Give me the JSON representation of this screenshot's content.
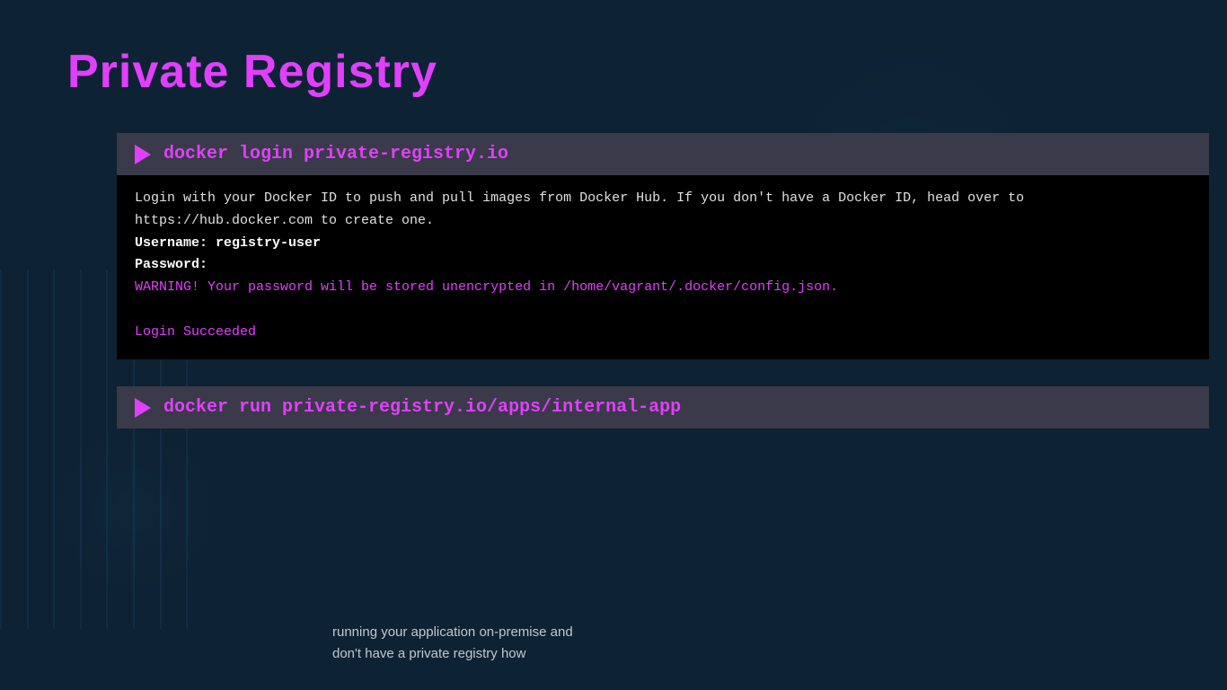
{
  "page": {
    "title": "Private Registry",
    "background_color": "#0d2233"
  },
  "terminal1": {
    "command": "docker login private-registry.io",
    "output_lines": [
      {
        "text": "Login with your Docker ID to push and pull images from Docker Hub. If you don't have a Docker ID, head over to",
        "style": "white"
      },
      {
        "text": "https://hub.docker.com to create one.",
        "style": "white"
      },
      {
        "text": "Username: registry-user",
        "style": "bold-white"
      },
      {
        "text": "Password:",
        "style": "bold-white"
      },
      {
        "text": "WARNING! Your password will be stored unencrypted in /home/vagrant/.docker/config.json.",
        "style": "warning"
      },
      {
        "text": "",
        "style": "white"
      },
      {
        "text": "Login Succeeded",
        "style": "success"
      }
    ]
  },
  "terminal2": {
    "command": "docker run private-registry.io/apps/internal-app"
  },
  "subtitle": {
    "line1": "running your application on-premise and",
    "line2": "don't have a private registry how"
  }
}
